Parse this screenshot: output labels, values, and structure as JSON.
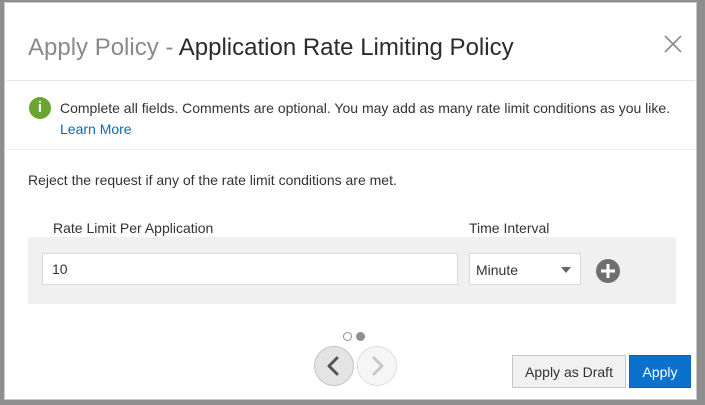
{
  "dialog": {
    "title_prefix": "Apply Policy",
    "title_separator": " - ",
    "title_policy": "Application Rate Limiting Policy",
    "close_icon": "close-icon"
  },
  "info": {
    "icon": "info-icon",
    "icon_glyph": "i",
    "icon_color": "#6aa431",
    "message": "Complete all fields. Comments are optional. You may add as many rate limit conditions as you like.",
    "learn_more": "Learn More"
  },
  "form": {
    "instruction": "Reject the request if any of the rate limit conditions are met.",
    "columns": {
      "rate_limit": "Rate Limit Per Application",
      "time_interval": "Time Interval"
    },
    "rows": [
      {
        "rate_limit_value": "10",
        "time_interval_value": "Minute"
      }
    ],
    "add_icon": "plus-circle-icon"
  },
  "pagination": {
    "pages": 2,
    "current_page": 2,
    "prev_icon": "chevron-left-icon",
    "next_icon": "chevron-right-icon"
  },
  "footer": {
    "draft_label": "Apply as Draft",
    "apply_label": "Apply",
    "apply_color": "#0a72cc"
  }
}
